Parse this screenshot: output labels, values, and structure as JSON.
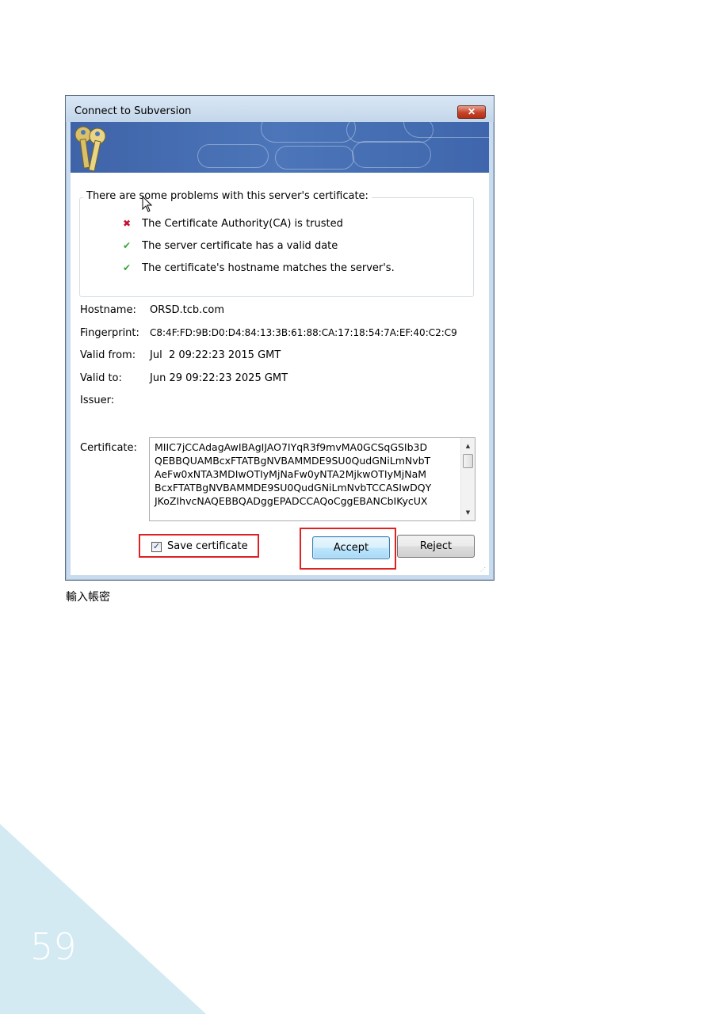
{
  "dialog": {
    "title": "Connect to Subversion",
    "close_symbol": "✕",
    "group_title": "There are some problems with this server's certificate:",
    "checks": [
      {
        "status": "fail",
        "symbol": "✖",
        "text": "The Certificate Authority(CA) is trusted"
      },
      {
        "status": "pass",
        "symbol": "✔",
        "text": "The server certificate has a valid date"
      },
      {
        "status": "pass",
        "symbol": "✔",
        "text": "The certificate's hostname matches the server's."
      }
    ],
    "fields": {
      "hostname_label": "Hostname:",
      "hostname_value": "ORSD.tcb.com",
      "fingerprint_label": "Fingerprint:",
      "fingerprint_value": "C8:4F:FD:9B:D0:D4:84:13:3B:61:88:CA:17:18:54:7A:EF:40:C2:C9",
      "valid_from_label": "Valid from:",
      "valid_from_value": "Jul  2 09:22:23 2015 GMT",
      "valid_to_label": "Valid to:",
      "valid_to_value": "Jun 29 09:22:23 2025 GMT",
      "issuer_label": "Issuer:",
      "issuer_value": "",
      "certificate_label": "Certificate:"
    },
    "certificate_lines": [
      "MIIC7jCCAdagAwIBAgIJAO7IYqR3f9mvMA0GCSqGSIb3D",
      "QEBBQUAMBcxFTATBgNVBAMMDE9SU0QudGNiLmNvbT",
      "AeFw0xNTA3MDIwOTIyMjNaFw0yNTA2MjkwOTIyMjNaM",
      "BcxFTATBgNVBAMMDE9SU0QudGNiLmNvbTCCASIwDQY",
      "JKoZIhvcNAQEBBQADggEPADCCAQoCggEBANCbIKycUX"
    ],
    "save_certificate": {
      "label": "Save certificate",
      "checked": true,
      "check_symbol": "✓"
    },
    "buttons": {
      "accept": "Accept",
      "reject": "Reject"
    },
    "highlight_color": "#dd2222"
  },
  "caption": "輸入帳密",
  "page_number": "59",
  "colors": {
    "corner": "#d3eaf2",
    "banner": "#4c76b9",
    "fail": "#c8102e",
    "pass": "#3aa33a"
  }
}
